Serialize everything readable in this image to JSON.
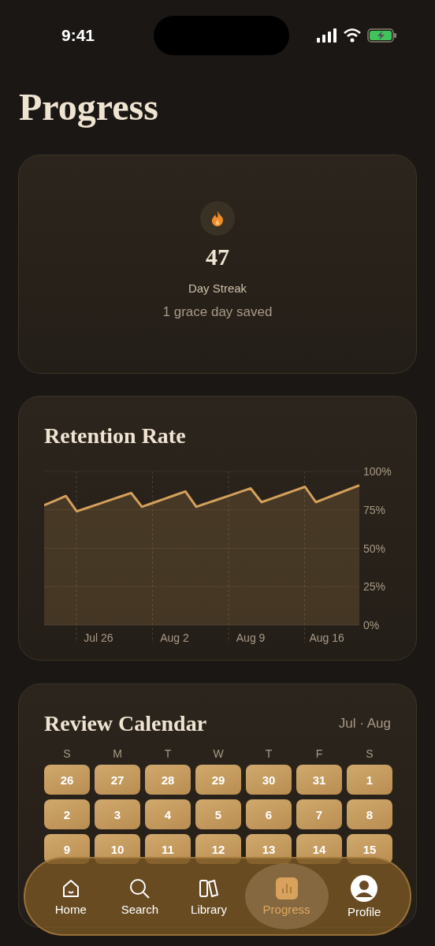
{
  "status_bar": {
    "time": "9:41"
  },
  "title": "Progress",
  "streak": {
    "count": "47",
    "label": "Day Streak",
    "note": "1 grace day saved"
  },
  "retention": {
    "title": "Retention Rate",
    "chart_data": {
      "type": "area",
      "categories": [
        null,
        null,
        null,
        null,
        null,
        "Jul 26",
        null,
        null,
        null,
        null,
        null,
        null,
        "Aug 2",
        null,
        null,
        null,
        null,
        null,
        null,
        "Aug 9",
        null,
        null,
        null,
        null,
        null,
        null,
        "Aug 16",
        null,
        null,
        null
      ],
      "series": [
        {
          "color": "#d4a05a",
          "values": [
            78,
            81,
            84,
            74,
            76.4,
            78.8,
            81.2,
            83.6,
            86,
            77,
            79.5,
            82,
            84.5,
            87,
            77,
            79.4,
            81.8,
            84.2,
            86.6,
            89,
            80,
            82.5,
            85,
            87.5,
            90,
            80,
            82.8,
            85.5,
            88.3,
            91
          ]
        }
      ],
      "ylim": [
        0,
        100
      ],
      "grid": true,
      "yticks": [
        {
          "value": 100,
          "label": "100%"
        },
        {
          "value": 75,
          "label": "75%"
        },
        {
          "value": 50,
          "label": "50%"
        },
        {
          "value": 25,
          "label": "25%"
        },
        {
          "value": 0,
          "label": "0%"
        }
      ]
    }
  },
  "calendar": {
    "title": "Review Calendar",
    "months": "Jul · Aug",
    "weekdays": [
      "S",
      "M",
      "T",
      "W",
      "T",
      "F",
      "S"
    ],
    "days": [
      "26",
      "27",
      "28",
      "29",
      "30",
      "31",
      "1",
      "2",
      "3",
      "4",
      "5",
      "6",
      "7",
      "8",
      "9",
      "10",
      "11",
      "12",
      "13",
      "14",
      "15"
    ]
  },
  "tab_bar": [
    {
      "label": "Home",
      "kind": "home",
      "selected": false
    },
    {
      "label": "Search",
      "kind": "search",
      "selected": false
    },
    {
      "label": "Library",
      "kind": "library",
      "selected": false
    },
    {
      "label": "Progress",
      "kind": "progress",
      "selected": true
    },
    {
      "label": "Profile",
      "kind": "profile",
      "selected": false
    }
  ]
}
